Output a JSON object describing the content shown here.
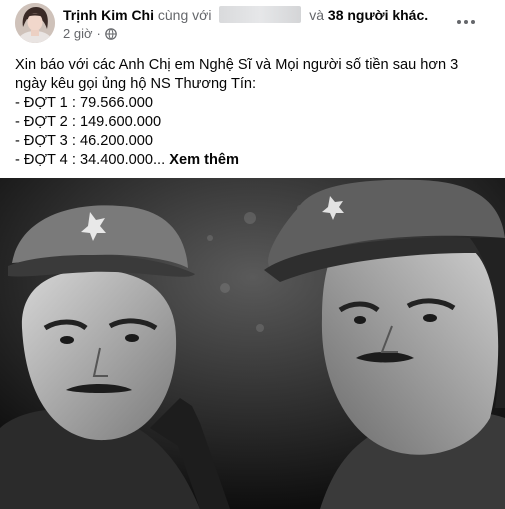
{
  "post": {
    "author": "Trịnh Kim Chi",
    "with_text": "cùng với",
    "and_text": "và",
    "others_text": "38 người khác.",
    "time": "2 giờ",
    "separator": "·",
    "privacy_icon": "globe-icon",
    "more_icon": "more-options-icon",
    "lines": [
      "Xin báo với các Anh Chị em Nghệ Sĩ và Mọi người số tiền sau hơn 3",
      "ngày kêu gọi ủng hộ NS Thương Tín:",
      "- ĐỢT 1 : 79.566.000",
      "- ĐỢT 2 : 149.600.000",
      "- ĐỢT 3 : 46.200.000",
      "- ĐỢT  4 : 34.400.000..."
    ],
    "see_more": "Xem thêm"
  },
  "colors": {
    "text": "#050505",
    "muted": "#65676b",
    "background": "#ffffff"
  }
}
